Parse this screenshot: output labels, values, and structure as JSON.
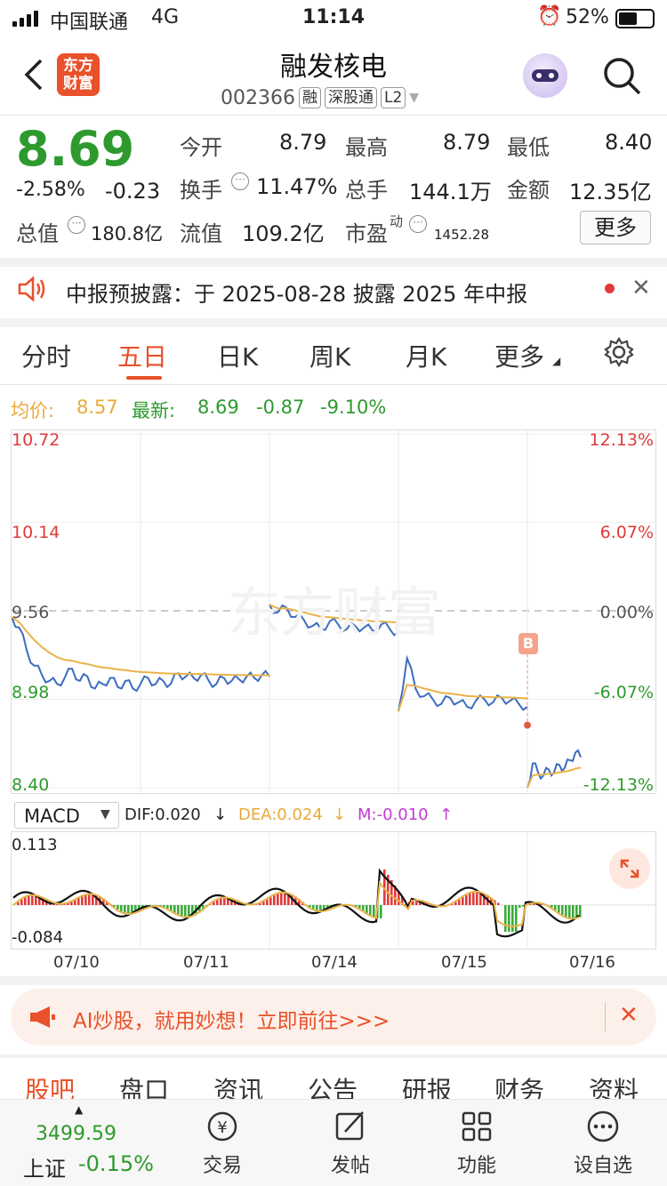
{
  "status": {
    "carrier": "中国联通",
    "network": "4G",
    "time": "11:14",
    "battery": "52%"
  },
  "header": {
    "title": "融发核电",
    "code": "002366",
    "tags": [
      "融",
      "深股通",
      "L2"
    ],
    "logo_text": "东方财富"
  },
  "quote": {
    "price": "8.69",
    "change_pct": "-2.58%",
    "change": "-0.23",
    "open_label": "今开",
    "open": "8.79",
    "high_label": "最高",
    "high": "8.79",
    "low_label": "最低",
    "low": "8.40",
    "turnover_label": "换手",
    "turnover": "11.47%",
    "volume_label": "总手",
    "volume": "144.1万",
    "amount_label": "金额",
    "amount": "12.35亿",
    "mktcap_label": "总值",
    "mktcap": "180.8亿",
    "float_label": "流值",
    "float": "109.2亿",
    "pe_label": "市盈",
    "pe_sup": "动",
    "pe": "1452.28",
    "more": "更多"
  },
  "notice": {
    "text": "中报预披露：于 2025-08-28 披露 2025 年中报"
  },
  "tabs": [
    "分时",
    "五日",
    "日K",
    "周K",
    "月K",
    "更多"
  ],
  "active_tab": "五日",
  "chart_info": {
    "avg_label": "均价:",
    "avg": "8.57",
    "latest_label": "最新:",
    "latest": "8.69",
    "chg": "-0.87",
    "pct": "-9.10%"
  },
  "chart_data": {
    "type": "line",
    "left_ticks": [
      "10.72",
      "10.14",
      "9.56",
      "8.98",
      "8.40"
    ],
    "right_ticks": [
      "12.13%",
      "6.07%",
      "0.00%",
      "-6.07%",
      "-12.13%"
    ],
    "x_labels": [
      "07/10",
      "07/11",
      "07/14",
      "07/15",
      "07/16"
    ],
    "series": [
      {
        "values": [
          9.52,
          9.45,
          9.3,
          9.2,
          9.14,
          9.1,
          9.08,
          9.12,
          9.18,
          9.1,
          9.13,
          9.05,
          9.08,
          9.12,
          9.06,
          9.1,
          9.05,
          9.08,
          9.12,
          9.08,
          9.1,
          9.08,
          9.15,
          9.13,
          9.12,
          9.14,
          9.1,
          9.08,
          9.12,
          9.1,
          9.11,
          9.13,
          9.12,
          9.14,
          9.13
        ],
        "day2": [
          9.6,
          9.55,
          9.58,
          9.52,
          9.5,
          9.46,
          9.44,
          9.49,
          9.47,
          9.44,
          9.46,
          9.45,
          9.43,
          9.47,
          9.44,
          9.42
        ],
        "day3": [
          8.9,
          9.25,
          9.05,
          9.0,
          8.98,
          8.95,
          8.99,
          8.96,
          8.93,
          8.97,
          8.98,
          8.96,
          8.99,
          8.97,
          8.95,
          8.93
        ],
        "day4": [
          8.4,
          8.56,
          8.5,
          8.48,
          8.52,
          8.5,
          8.55,
          8.53,
          8.58,
          8.63,
          8.6
        ]
      }
    ],
    "point_label": "B"
  },
  "macd": {
    "label": "MACD",
    "dif": "DIF:0.020",
    "dea": "DEA:0.024",
    "m": "M:-0.010",
    "top": "0.113",
    "bottom": "-0.084"
  },
  "ai": {
    "text": "AI炒股，就用妙想！立即前往>>>"
  },
  "bottom_tabs": [
    "股吧",
    "盘口",
    "资讯",
    "公告",
    "研报",
    "财务",
    "资料"
  ],
  "dock": {
    "index_value": "3499.59",
    "index_name": "上证",
    "index_chg": "-0.15%",
    "items": [
      "交易",
      "发帖",
      "功能",
      "设自选"
    ]
  }
}
